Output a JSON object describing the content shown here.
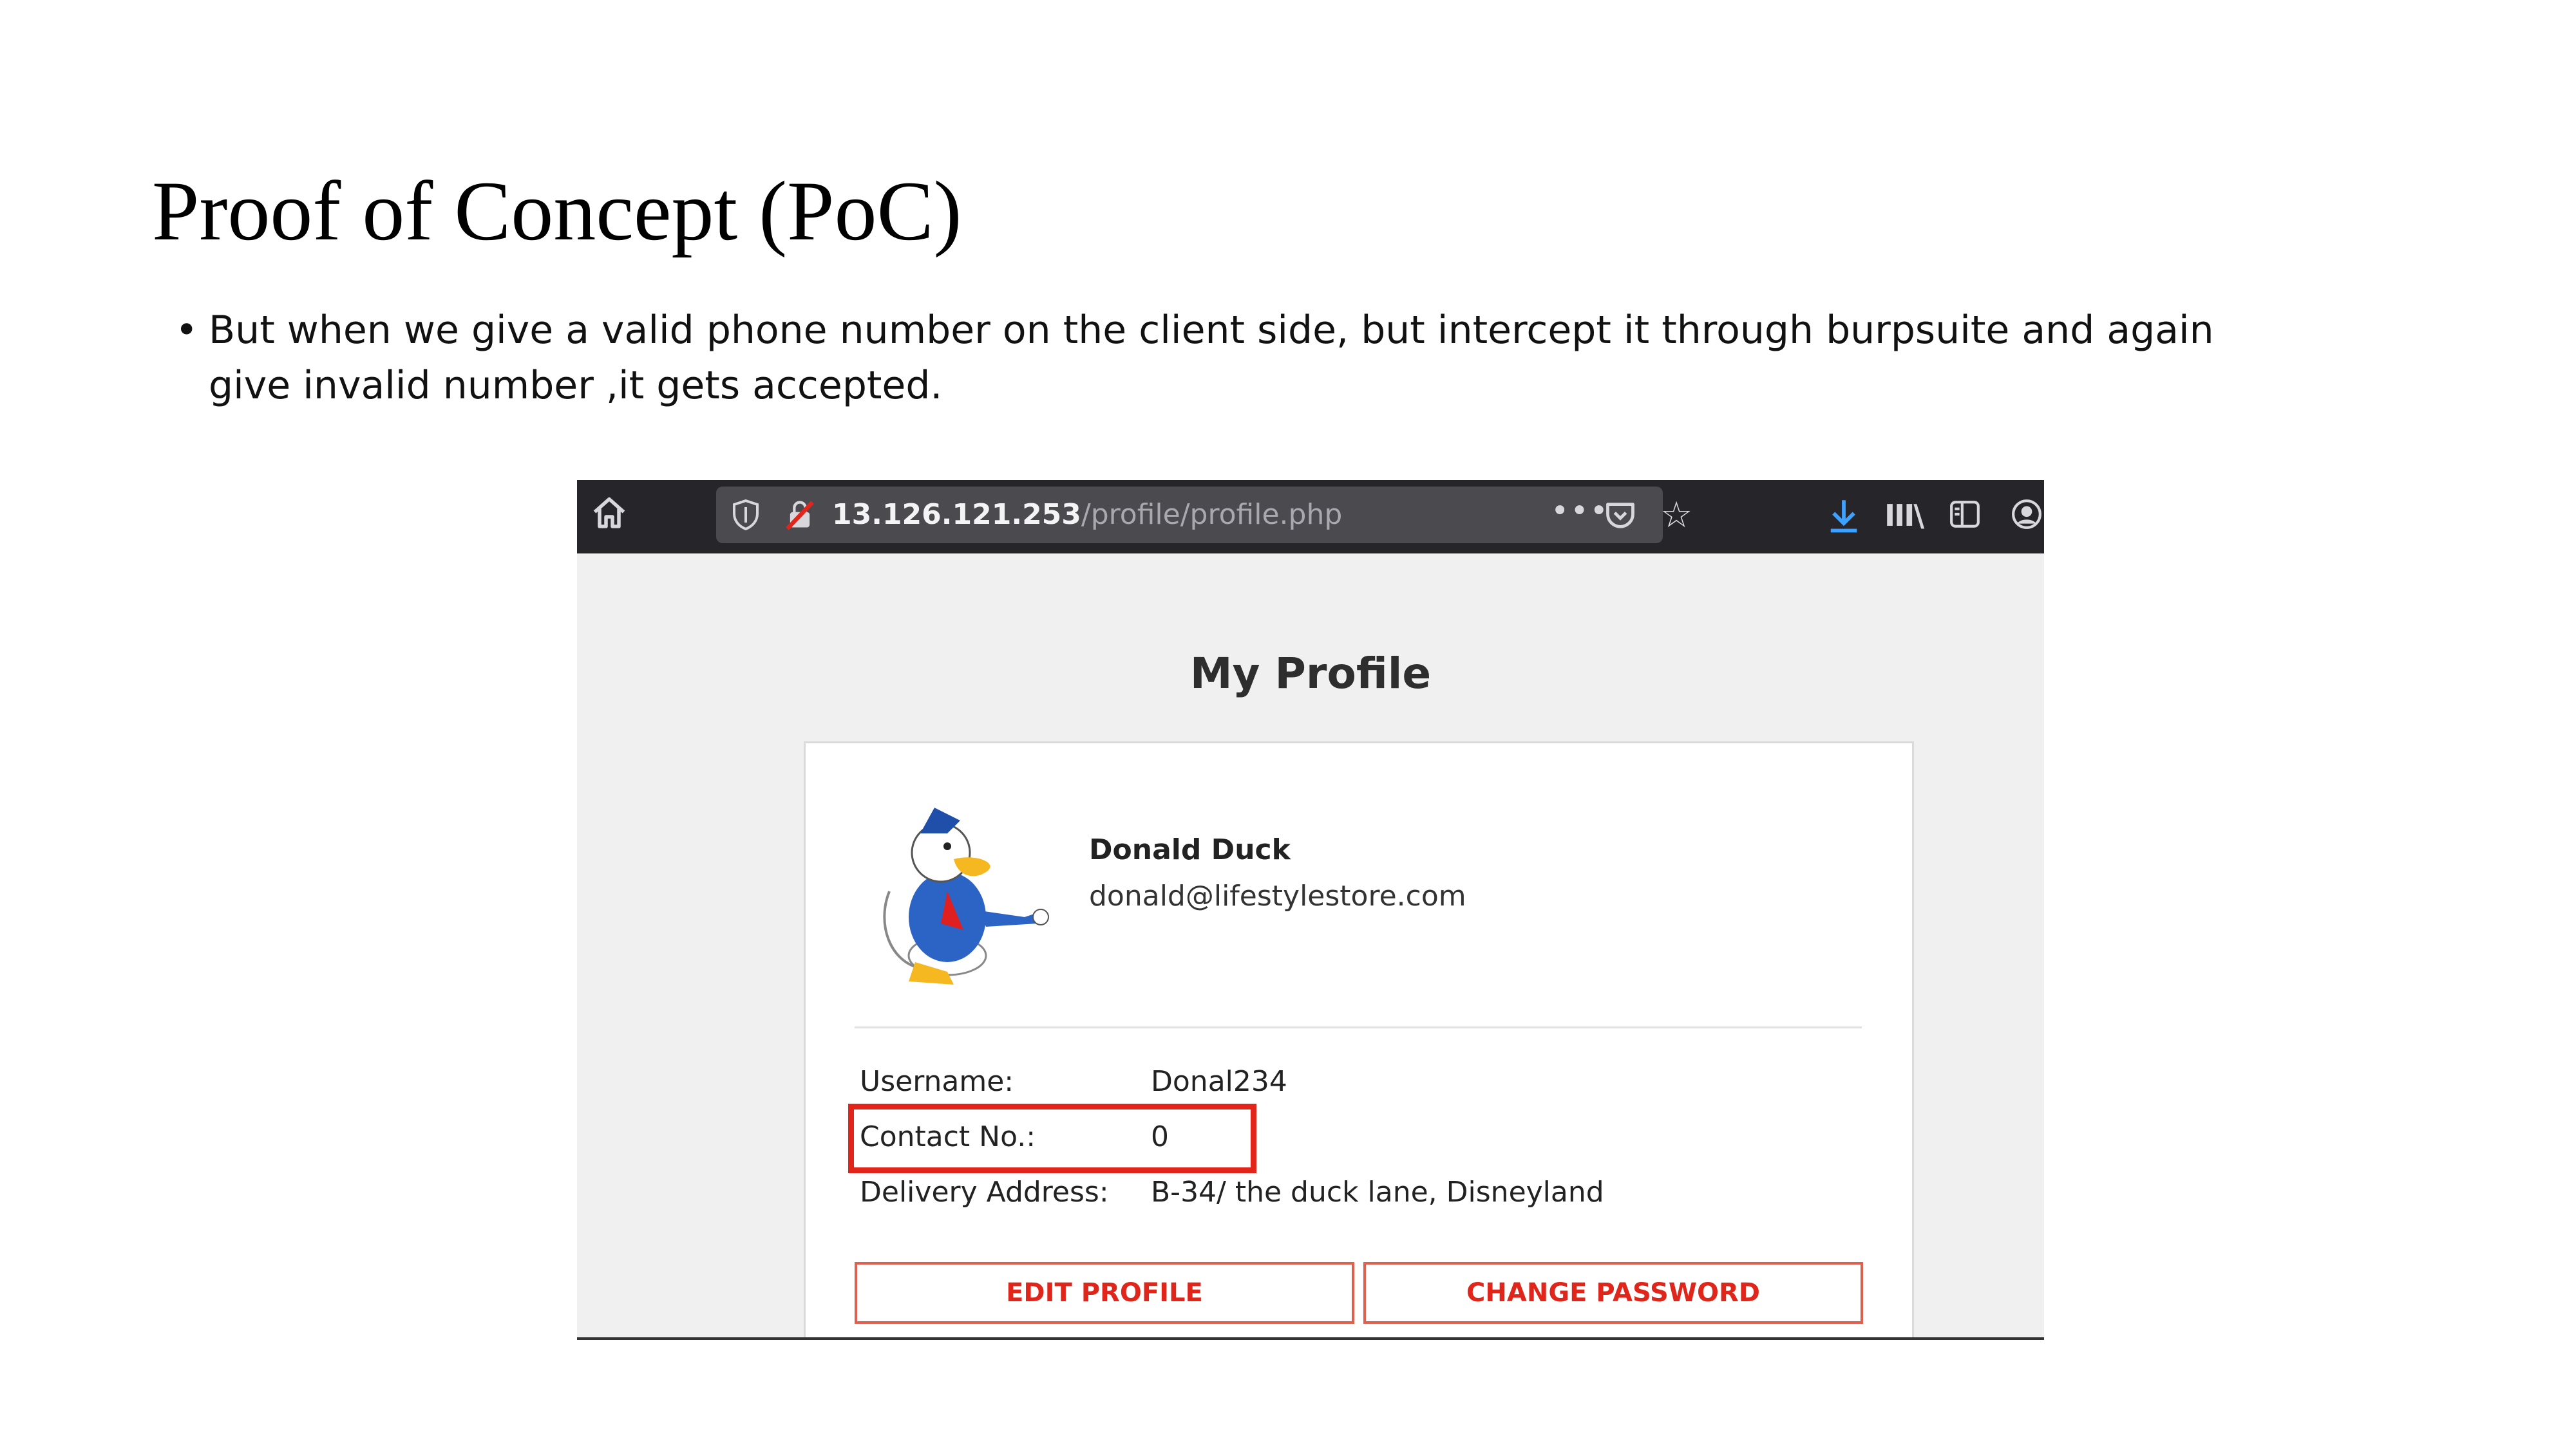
{
  "slide": {
    "title": "Proof of Concept (PoC)",
    "bullet": "But when we give a valid phone number on the client side, but intercept it through burpsuite and again give invalid number ,it gets accepted."
  },
  "browser": {
    "url_host": "13.126.121.253",
    "url_path": "/profile/profile.php",
    "more_glyph": "•••",
    "star_glyph": "☆",
    "library_glyph": "III\\"
  },
  "profile": {
    "heading": "My Profile",
    "name": "Donald Duck",
    "email": "donald@lifestylestore.com",
    "fields": [
      {
        "label": "Username:",
        "value": "Donal234"
      },
      {
        "label": "Contact No.:",
        "value": "0"
      },
      {
        "label": "Delivery Address:",
        "value": "B-34/ the duck lane, Disneyland"
      }
    ],
    "edit_button": "EDIT PROFILE",
    "change_password_button": "CHANGE PASSWORD"
  },
  "colors": {
    "highlight": "#e1251b",
    "toolbar": "#26262a",
    "button_text": "#e0251b"
  }
}
